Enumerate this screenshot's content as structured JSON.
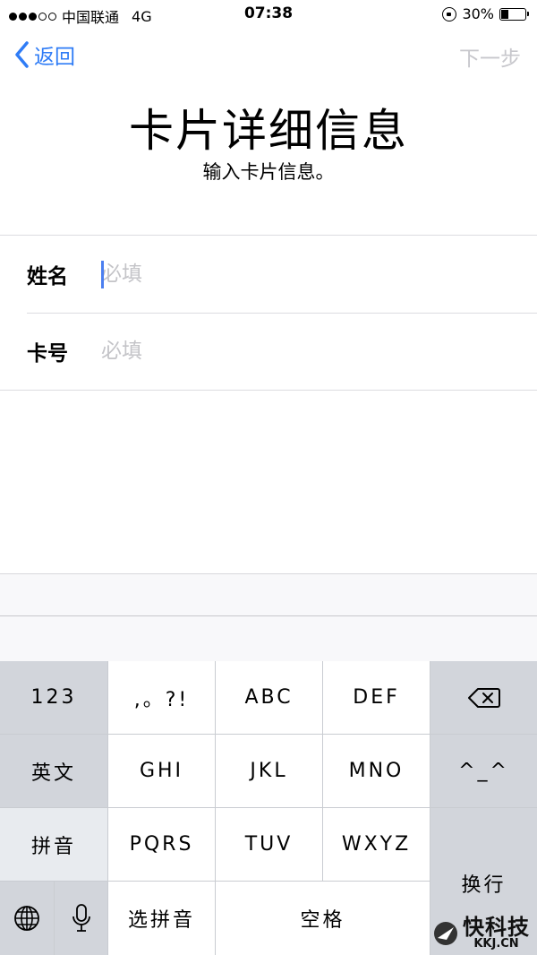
{
  "status_bar": {
    "carrier": "中国联通",
    "network": "4G",
    "time": "07:38",
    "battery_percent": "30%",
    "battery_level": 0.3,
    "signal_bars_filled": 3,
    "signal_bars_total": 5
  },
  "nav": {
    "back_label": "返回",
    "next_label": "下一步"
  },
  "header": {
    "title": "卡片详细信息",
    "subtitle": "输入卡片信息。"
  },
  "form": {
    "name_label": "姓名",
    "name_placeholder": "必填",
    "card_label": "卡号",
    "card_placeholder": "必填"
  },
  "keyboard": {
    "k_123": "123",
    "k_punct": ",。?!",
    "k_abc": "ABC",
    "k_def": "DEF",
    "k_english": "英文",
    "k_ghi": "GHI",
    "k_jkl": "JKL",
    "k_mno": "MNO",
    "k_emoticon": "^_^",
    "k_pinyin": "拼音",
    "k_pqrs": "PQRS",
    "k_tuv": "TUV",
    "k_wxyz": "WXYZ",
    "k_return": "换行",
    "k_select_pinyin": "选拼音",
    "k_space": "空格"
  },
  "watermark": {
    "brand": "快科技",
    "domain": "KKJ.CN"
  },
  "colors": {
    "accent": "#2f7cf6",
    "disabled_text": "#c7c7cc",
    "placeholder": "#c4c4c8",
    "caret": "#4b7ff0",
    "keyboard_bg": "#c9ccd1"
  }
}
